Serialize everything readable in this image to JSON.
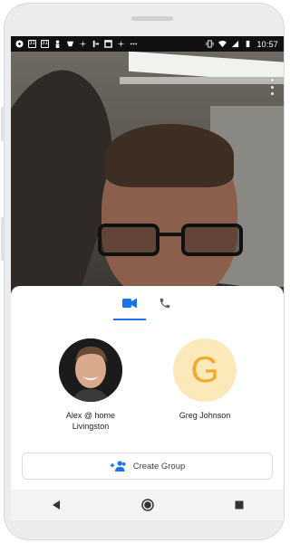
{
  "status_bar": {
    "calendar_day_1": "31",
    "calendar_day_2": "31",
    "time": "10:57"
  },
  "tabs": [
    {
      "icon": "video-icon",
      "selected": true
    },
    {
      "icon": "phone-icon",
      "selected": false
    }
  ],
  "contacts": [
    {
      "name_line1": "Alex @ home",
      "name_line2": "Livingston",
      "avatar": "photo"
    },
    {
      "name_line1": "Greg Johnson",
      "name_line2": "",
      "avatar_letter": "G"
    }
  ],
  "create_group": {
    "label": "Create Group"
  },
  "colors": {
    "accent": "#1a73e8",
    "avatar_letter_color": "#f0a92b",
    "avatar_letter_bg": "#fce9b9"
  }
}
